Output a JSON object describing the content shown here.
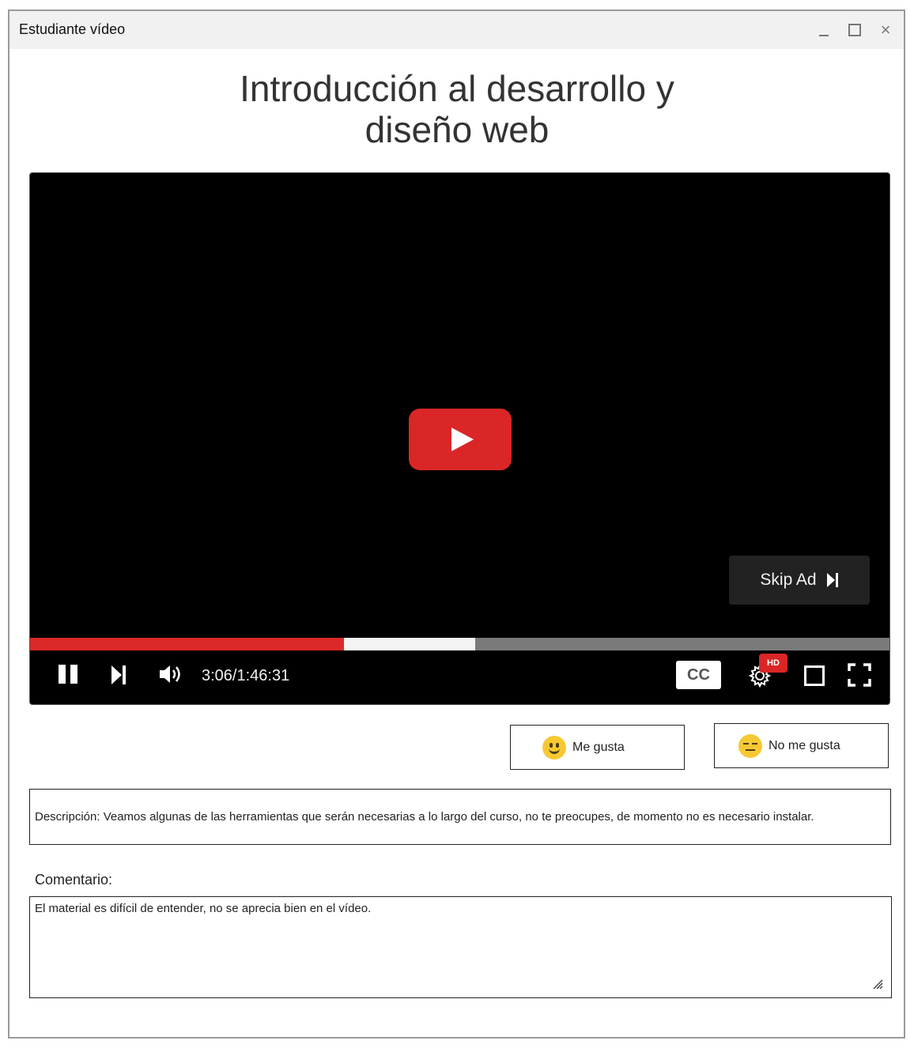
{
  "window": {
    "title": "Estudiante vídeo",
    "controls": {
      "minimize": "_",
      "maximize": "□",
      "close": "×"
    }
  },
  "page": {
    "title": "Introducción al desarrollo y\ndiseño web"
  },
  "player": {
    "skip_ad_label": "Skip Ad",
    "time_display": "3:06/1:46:31",
    "cc_label": "CC",
    "hd_badge": "HD",
    "progress_played_fraction": 0.365,
    "progress_buffered_fraction": 0.517,
    "colors": {
      "accent": "#da2626",
      "progress_track": "#7a7a7a",
      "buffered": "#f4f4f4"
    },
    "icons": [
      "play-icon",
      "pause-icon",
      "next-icon",
      "volume-icon",
      "gear-icon",
      "theater-icon",
      "fullscreen-icon",
      "skip-icon"
    ]
  },
  "reactions": {
    "like_label": "Me gusta",
    "dislike_label": "No me gusta"
  },
  "description": {
    "text": "Descripción: Veamos algunas de las herramientas que serán necesarias a lo largo del curso, no te preocupes, de momento no es necesario instalar."
  },
  "comment": {
    "label": "Comentario:",
    "value": "El material es difícil de entender, no se aprecia bien en el vídeo."
  }
}
